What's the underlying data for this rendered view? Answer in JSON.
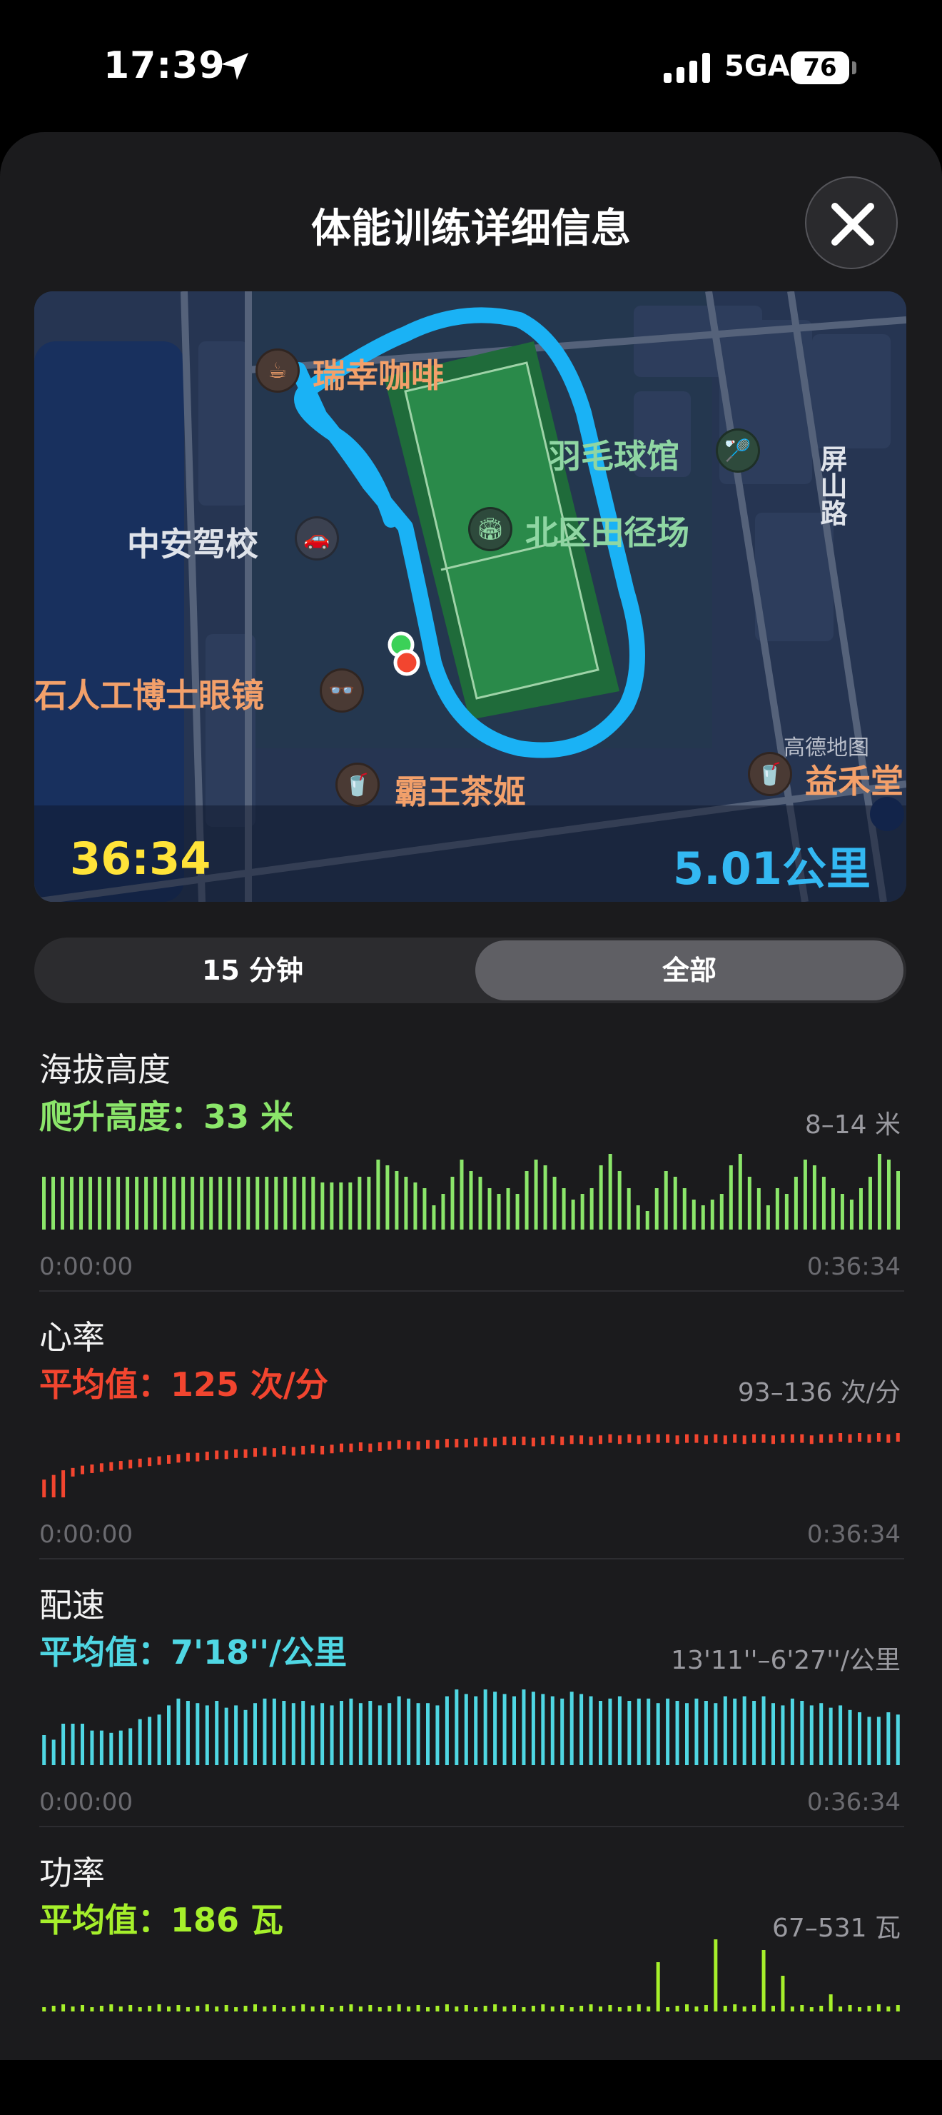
{
  "status_bar": {
    "time": "17:39",
    "network": "5GA",
    "battery": "76"
  },
  "header": {
    "title": "体能训练详细信息"
  },
  "map": {
    "pois": {
      "ruixing": "瑞幸咖啡",
      "badminton": "羽毛球馆",
      "zhongan": "中安驾校",
      "stadium": "北区田径场",
      "glasses": "石人工博士眼镜",
      "bawang": "霸王茶姬",
      "yihe": "益禾堂",
      "road": "屏山路"
    },
    "attribution": "高德地图",
    "duration": "36:34",
    "distance": "5.01公里"
  },
  "segment": {
    "left": "15 分钟",
    "right": "全部",
    "selected": "全部"
  },
  "colors": {
    "altitude": "#8be66a",
    "heart": "#f2452f",
    "pace": "#4fd7e3",
    "power": "#a6f02b",
    "route": "#1ab2f5",
    "time": "#ffe339"
  },
  "metrics": {
    "altitude": {
      "title": "海拔高度",
      "summary": "爬升高度：33 米",
      "range": "8–14 米",
      "start": "0:00:00",
      "end": "0:36:34",
      "values": [
        12,
        12,
        12,
        12,
        12,
        12,
        12,
        12,
        12,
        12,
        12,
        12,
        12,
        12,
        12,
        12,
        12,
        12,
        12,
        12,
        12,
        12,
        12,
        12,
        12,
        12,
        12,
        12,
        12,
        12,
        11.5,
        11.5,
        11.5,
        11.5,
        12,
        12,
        13.5,
        13,
        12.5,
        12,
        11.5,
        11,
        9.5,
        10.5,
        12,
        13.5,
        12.5,
        12,
        11,
        10.5,
        11,
        10.5,
        12.5,
        13.5,
        13,
        12,
        11,
        10,
        10.5,
        11,
        13,
        14,
        12.5,
        11,
        9.5,
        9,
        11,
        12.5,
        12,
        11,
        10,
        9.5,
        10,
        10.5,
        13,
        14,
        12,
        11,
        9.5,
        11,
        10.5,
        12,
        13.5,
        13,
        12,
        11,
        10.5,
        10,
        11,
        12,
        14,
        13.5,
        12.5
      ]
    },
    "heart": {
      "title": "心率",
      "summary": "平均值：125 次/分",
      "range": "93–136 次/分",
      "start": "0:00:00",
      "end": "0:36:34",
      "values": [
        96,
        100,
        104,
        106,
        108,
        109,
        110,
        111,
        112,
        113,
        114,
        115,
        116,
        117,
        118,
        119,
        119,
        120,
        121,
        121,
        122,
        122,
        123,
        124,
        123,
        125,
        124,
        125,
        126,
        125,
        126,
        127,
        127,
        128,
        127,
        128,
        129,
        130,
        129,
        129,
        130,
        130,
        131,
        131,
        131,
        132,
        132,
        132,
        133,
        133,
        133,
        132,
        133,
        134,
        133,
        134,
        134,
        133,
        134,
        135,
        134,
        135,
        134,
        135,
        135,
        135,
        134,
        135,
        135,
        134,
        135,
        134,
        135,
        134,
        135,
        135,
        134,
        135,
        135,
        135,
        134,
        135,
        135,
        136,
        135,
        136,
        135,
        136,
        135,
        136
      ]
    },
    "pace": {
      "title": "配速",
      "summary": "平均值：7'18''/公里",
      "range": "13'11''–6'27''/公里",
      "start": "0:00:00",
      "end": "0:36:34",
      "values": [
        40,
        36,
        50,
        50,
        50,
        44,
        44,
        42,
        44,
        46,
        54,
        56,
        58,
        66,
        72,
        70,
        68,
        66,
        70,
        64,
        66,
        62,
        68,
        72,
        72,
        70,
        68,
        70,
        66,
        68,
        66,
        70,
        72,
        68,
        70,
        66,
        68,
        74,
        72,
        68,
        68,
        66,
        74,
        80,
        76,
        74,
        80,
        78,
        76,
        74,
        80,
        78,
        76,
        74,
        72,
        78,
        76,
        74,
        70,
        72,
        74,
        70,
        72,
        72,
        68,
        72,
        70,
        68,
        72,
        70,
        68,
        74,
        72,
        74,
        70,
        74,
        68,
        66,
        72,
        70,
        66,
        68,
        64,
        66,
        62,
        60,
        56,
        56,
        60,
        58
      ]
    },
    "power": {
      "title": "功率",
      "summary": "平均值：186 瓦",
      "range": "67–531 瓦"
    }
  }
}
